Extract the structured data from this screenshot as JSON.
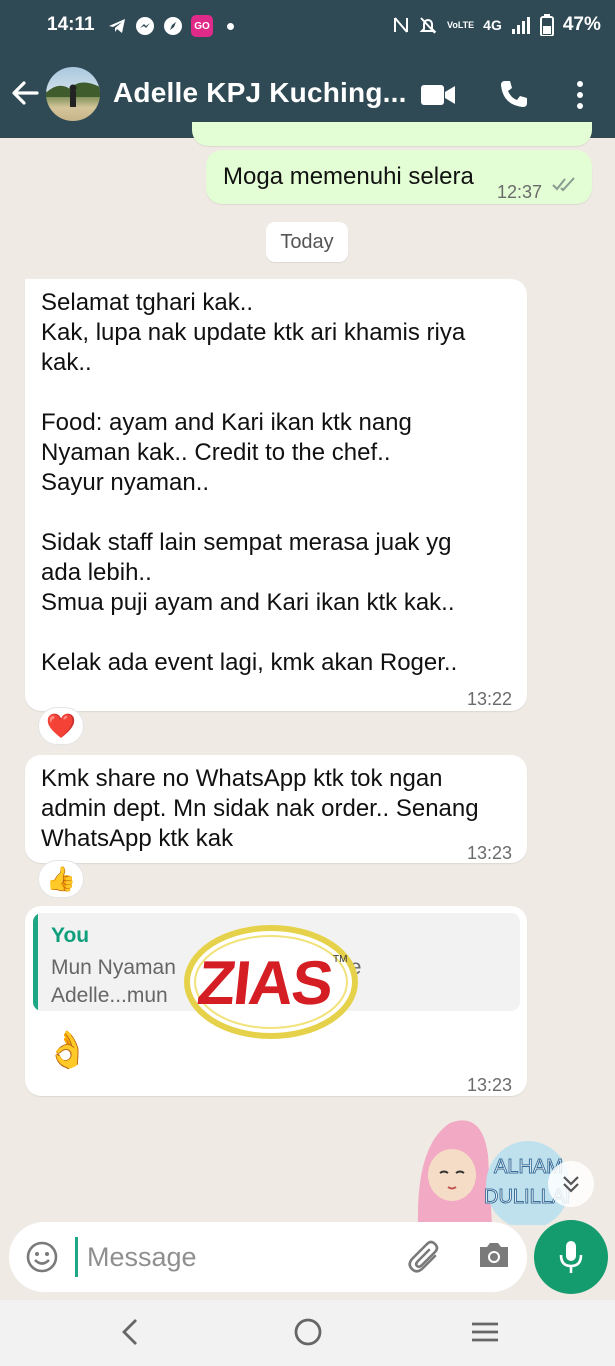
{
  "status": {
    "time": "14:11",
    "go_badge": "GO",
    "network": "4G",
    "battery": "47%"
  },
  "header": {
    "contact_name": "Adelle KPJ Kuching..."
  },
  "messages": [
    {
      "type": "outgoing",
      "text": "Moga memenuhi selera",
      "time": "12:37"
    },
    {
      "type": "date",
      "text": "Today"
    },
    {
      "type": "incoming",
      "lines": [
        "Selamat tghari kak..",
        "Kak, lupa nak update ktk ari khamis riya",
        "kak..",
        "",
        "Food: ayam and Kari ikan ktk nang",
        "Nyaman kak.. Credit to the chef..",
        "Sayur nyaman..",
        "",
        "Sidak staff lain sempat merasa juak yg",
        "ada lebih..",
        "Smua puji ayam and Kari ikan ktk kak..",
        "",
        "Kelak ada event lagi, kmk akan Roger.."
      ],
      "time": "13:22",
      "reaction": "❤️"
    },
    {
      "type": "incoming",
      "lines": [
        "Kmk share no WhatsApp ktk tok ngan",
        "admin dept. Mn sidak nak order.. Senang",
        "WhatsApp ktk kak"
      ],
      "time": "13:23",
      "reaction": "👍"
    },
    {
      "type": "incoming",
      "quote_author": "You",
      "quote_text": "Mun Nyaman              w kat Page\nAdelle...mun              kak😘😁",
      "text": "👌",
      "time": "13:23"
    }
  ],
  "watermark": "ZIAS",
  "sticker_text": [
    "ALHAM",
    "DULILLAH"
  ],
  "composer": {
    "placeholder": "Message"
  }
}
